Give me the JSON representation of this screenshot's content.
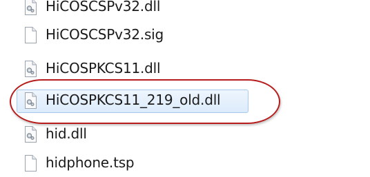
{
  "files": [
    {
      "name": "HiCOSCSPv32.dll",
      "icon": "dll-file-icon",
      "selected": false
    },
    {
      "name": "HiCOSCSPv32.sig",
      "icon": "blank-file-icon",
      "selected": false
    },
    {
      "name": "HiCOSPKCS11.dll",
      "icon": "dll-file-icon",
      "selected": false
    },
    {
      "name": "HiCOSPKCS11_219_old.dll",
      "icon": "dll-file-icon",
      "selected": true
    },
    {
      "name": "hid.dll",
      "icon": "dll-file-icon",
      "selected": false
    },
    {
      "name": "hidphone.tsp",
      "icon": "blank-file-icon",
      "selected": false
    }
  ],
  "colors": {
    "highlight_ring": "#b71c1c",
    "selection_fill": "#dcebfc",
    "selection_border": "#a8c8ee",
    "text": "#1a1a1a"
  }
}
